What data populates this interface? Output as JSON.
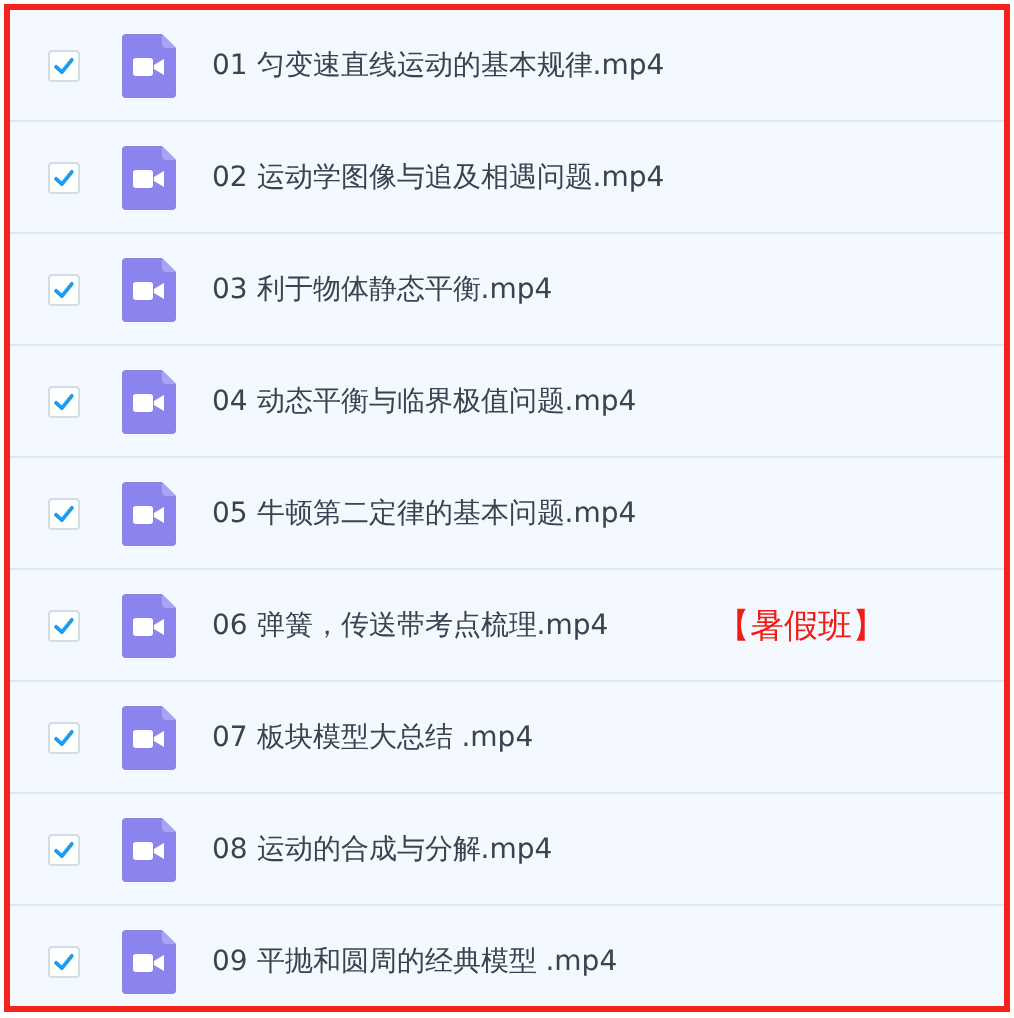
{
  "files": [
    {
      "name": "01 匀变速直线运动的基本规律.mp4",
      "checked": true
    },
    {
      "name": "02 运动学图像与追及相遇问题.mp4",
      "checked": true
    },
    {
      "name": "03 利于物体静态平衡.mp4",
      "checked": true
    },
    {
      "name": "04 动态平衡与临界极值问题.mp4",
      "checked": true
    },
    {
      "name": "05 牛顿第二定律的基本问题.mp4",
      "checked": true
    },
    {
      "name": "06 弹簧，传送带考点梳理.mp4",
      "checked": true,
      "note": "【暑假班】"
    },
    {
      "name": "07 板块模型大总结 .mp4",
      "checked": true
    },
    {
      "name": "08 运动的合成与分解.mp4",
      "checked": true
    },
    {
      "name": "09 平抛和圆周的经典模型 .mp4",
      "checked": true
    }
  ]
}
